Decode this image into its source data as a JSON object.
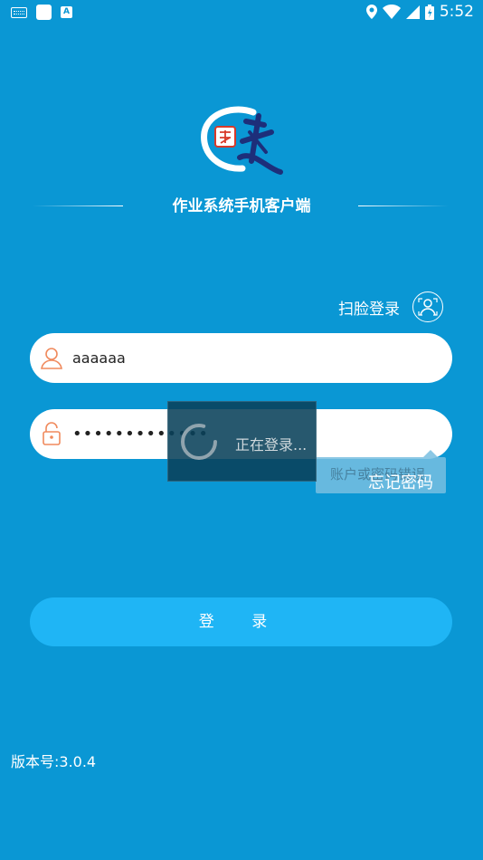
{
  "statusbar": {
    "time": "5:52"
  },
  "app": {
    "title": "作业系统手机客户端"
  },
  "face_login": {
    "label": "扫脸登录"
  },
  "username": {
    "value": "aaaaaa"
  },
  "password": {
    "value": "•••••••••••••"
  },
  "forgot": {
    "label": "忘记密码",
    "error_text": "账户或密码错误"
  },
  "loading": {
    "text": "正在登录..."
  },
  "login_button": {
    "label": "登 录"
  },
  "version": {
    "text": "版本号:3.0.4"
  },
  "colors": {
    "background": "#0a97d4",
    "button": "#1fb5f5",
    "icon_accent": "#f08a5d"
  }
}
